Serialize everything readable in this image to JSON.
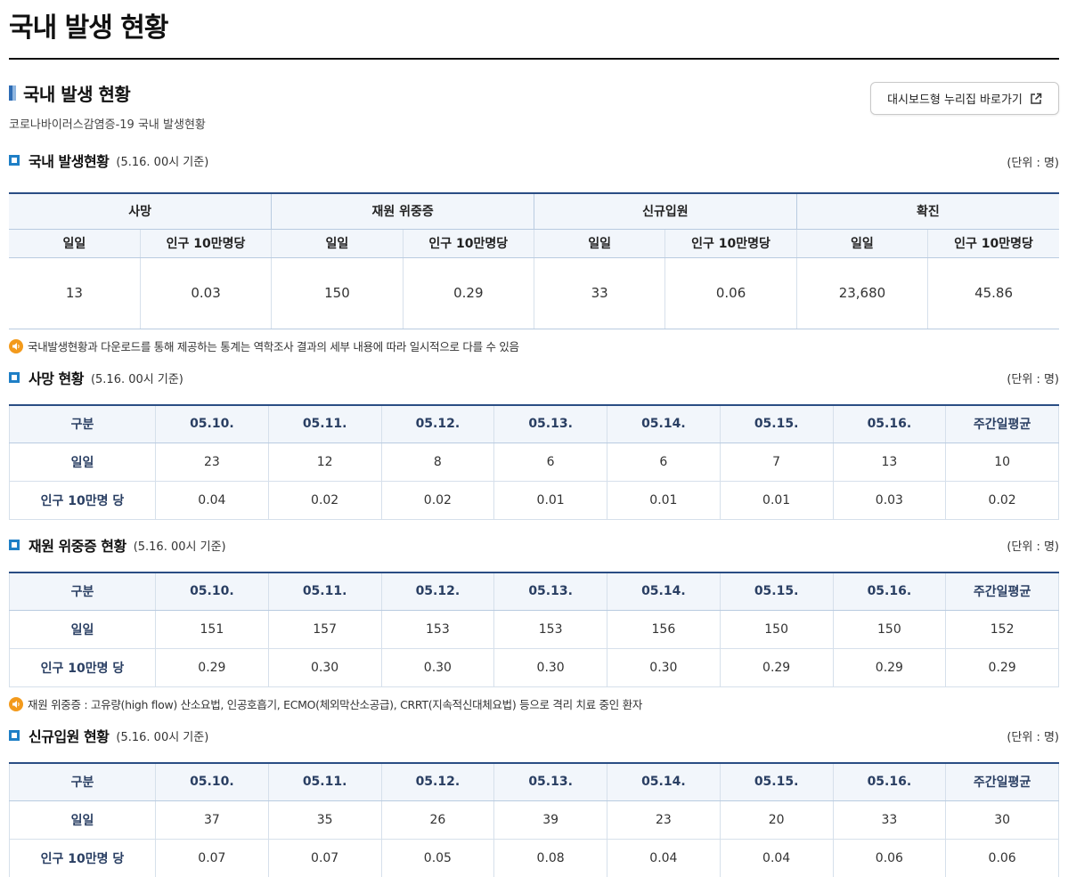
{
  "page": {
    "title": "국내 발생 현황"
  },
  "section": {
    "title": "국내 발생 현황",
    "desc": "코로나바이러스감염증-19 국내 발생현황",
    "dashboard_btn": "대시보드형 누리집 바로가기"
  },
  "unit_label": "(단위 : 명)",
  "summary": {
    "title": "국내 발생현황",
    "basis": "(5.16. 00시 기준)",
    "groups": [
      "사망",
      "재원 위중증",
      "신규입원",
      "확진"
    ],
    "sub_daily": "일일",
    "sub_per": "인구 10만명당",
    "values": [
      "13",
      "0.03",
      "150",
      "0.29",
      "33",
      "0.06",
      "23,680",
      "45.86"
    ]
  },
  "note1": "국내발생현황과 다운로드를 통해 제공하는 통계는 역학조사 결과의 세부 내용에 따라 일시적으로 다를 수 있음",
  "note2": "재원 위중증 : 고유량(high flow) 산소요법, 인공호흡기, ECMO(체외막산소공급), CRRT(지속적신대체요법) 등으로 격리 치료 중인 환자",
  "columns": [
    "구분",
    "05.10.",
    "05.11.",
    "05.12.",
    "05.13.",
    "05.14.",
    "05.15.",
    "05.16.",
    "주간일평균"
  ],
  "row_daily": "일일",
  "row_per": "인구 10만명 당",
  "deaths": {
    "title": "사망 현황",
    "basis": "(5.16. 00시 기준)",
    "daily": [
      "23",
      "12",
      "8",
      "6",
      "6",
      "7",
      "13",
      "10"
    ],
    "per": [
      "0.04",
      "0.02",
      "0.02",
      "0.01",
      "0.01",
      "0.01",
      "0.03",
      "0.02"
    ]
  },
  "critical": {
    "title": "재원 위중증 현황",
    "basis": "(5.16. 00시 기준)",
    "daily": [
      "151",
      "157",
      "153",
      "153",
      "156",
      "150",
      "150",
      "152"
    ],
    "per": [
      "0.29",
      "0.30",
      "0.30",
      "0.30",
      "0.30",
      "0.29",
      "0.29",
      "0.29"
    ]
  },
  "admission": {
    "title": "신규입원 현황",
    "basis": "(5.16. 00시 기준)",
    "daily": [
      "37",
      "35",
      "26",
      "39",
      "23",
      "20",
      "33",
      "30"
    ],
    "per": [
      "0.07",
      "0.07",
      "0.05",
      "0.08",
      "0.04",
      "0.04",
      "0.06",
      "0.06"
    ]
  },
  "colors": {
    "accent": "#2a4d84",
    "header_bg": "#f2f6fb",
    "note_icon": "#f39a1c",
    "square": "#1f7fc6"
  },
  "icons": {
    "external": "external-link-icon",
    "speaker": "speaker-icon"
  }
}
